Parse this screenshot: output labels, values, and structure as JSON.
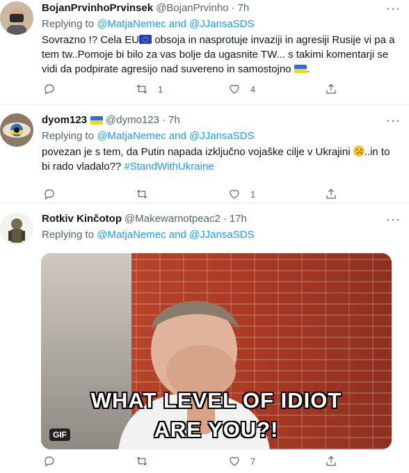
{
  "tweets": [
    {
      "name": "BojanPrvinhoPrvinsek",
      "handle": "@BojanPrvinho",
      "dot": "·",
      "time": "7h",
      "replying_prefix": "Replying to",
      "replying_users": "@MatjaNemec and @JJansaSDS",
      "text_part1": "Sovrazno !?  Cela EU",
      "text_part2": " obsoja in nasprotuje invaziji in agresiji Rusije vi pa a tem tw..Pomoje bi bilo za vas bolje da ugasnite TW... s takimi komentarji se vidi da podpirate agresijo nad suvereno in samostojno ",
      "text_part3": ".",
      "retweets": "1",
      "likes": "4",
      "replies": ""
    },
    {
      "name": "dyom123",
      "handle": "@dymo123",
      "dot": "·",
      "time": "7h",
      "replying_prefix": "Replying to",
      "replying_users": "@MatjaNemec and @JJansaSDS",
      "text_part1": "povezan je s tem, da Putin napada izključno vojaške cilje v Ukrajini ",
      "text_part2": "..in to bi rado vladalo?? ",
      "hashtag": "#StandWithUkraine",
      "retweets": "",
      "likes": "1",
      "replies": ""
    },
    {
      "name": "Rotkiv Kinčotop",
      "handle": "@Makewarnotpeac2",
      "dot": "·",
      "time": "17h",
      "replying_prefix": "Replying to",
      "replying_users": "@MatjaNemec and @JJansaSDS",
      "gif_caption_line1": "WHAT LEVEL OF IDIOT",
      "gif_caption_line2": "ARE YOU?!",
      "gif_badge": "GIF",
      "retweets": "",
      "likes": "7",
      "replies": ""
    }
  ],
  "more_label": "···",
  "colors": {
    "link": "#1d9bf0",
    "muted": "#536471",
    "text": "#0f1419"
  },
  "icons": [
    "reply-icon",
    "retweet-icon",
    "like-icon",
    "share-icon",
    "more-icon"
  ]
}
